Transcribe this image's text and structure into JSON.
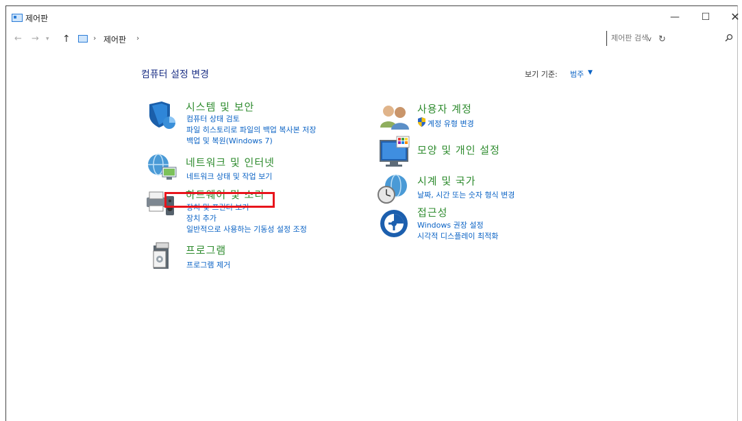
{
  "window": {
    "title": "제어판",
    "minimize": "—",
    "maximize": "☐",
    "close": "✕"
  },
  "nav": {
    "back": "←",
    "forward": "→",
    "recent": "▾",
    "up": "↑"
  },
  "address": {
    "separator": "›",
    "crumb": "제어판",
    "dropdown": "v",
    "refresh": "↻"
  },
  "search": {
    "placeholder": "제어판 검색",
    "icon": "search-icon"
  },
  "main": {
    "heading": "컴퓨터 설정 변경",
    "view_by_label": "보기 기준:",
    "view_by_value": "범주",
    "view_by_caret": "▼"
  },
  "categories": {
    "system": {
      "title": "시스템 및 보안",
      "icon": "shield-icon",
      "links": [
        "컴퓨터 상태 검토",
        "파일 히스토리로 파일의 백업 복사본 저장",
        "백업 및 복원(Windows 7)"
      ]
    },
    "network": {
      "title": "네트워크 및 인터넷",
      "icon": "globe-network-icon",
      "links": [
        "네트워크 상태 및 작업 보기"
      ]
    },
    "hardware": {
      "title": "하드웨어 및 소리",
      "icon": "printer-speaker-icon",
      "links": [
        "장치 및 프린터 보기",
        "장치 추가",
        "일반적으로 사용하는 기동성 설정 조정"
      ]
    },
    "programs": {
      "title": "프로그램",
      "icon": "program-box-icon",
      "links": [
        "프로그램 제거"
      ]
    },
    "users": {
      "title": "사용자 계정",
      "icon": "users-icon",
      "links": [
        "계정 유형 변경"
      ],
      "link_icon": "uac-shield-icon"
    },
    "appearance": {
      "title": "모양 및 개인 설정",
      "icon": "monitor-icon"
    },
    "clock": {
      "title": "시계 및 국가",
      "icon": "clock-globe-icon",
      "links": [
        "날짜, 시간 또는 숫자 형식 변경"
      ]
    },
    "access": {
      "title": "접근성",
      "icon": "ease-of-access-icon",
      "links": [
        "Windows 권장 설정",
        "시각적 디스플레이 최적화"
      ]
    }
  },
  "colors": {
    "category_title": "#2e8b2e",
    "link": "#0b63c5",
    "heading": "#1e3287",
    "highlight": "#e8141b"
  }
}
